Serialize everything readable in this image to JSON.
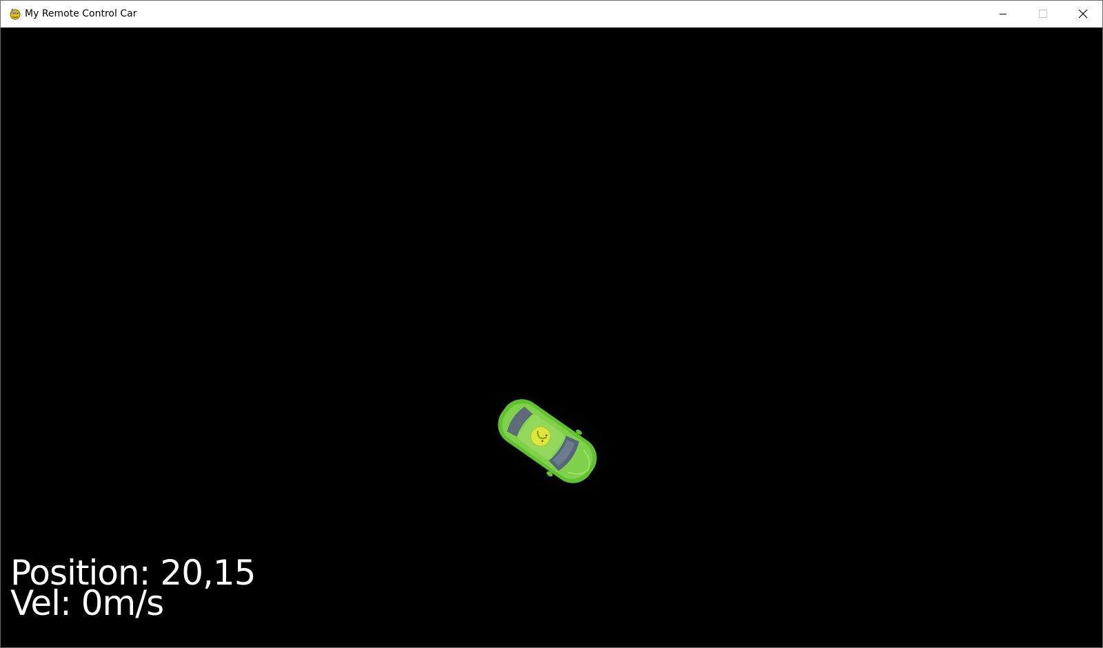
{
  "window": {
    "title": "My Remote Control Car",
    "app_icon": "pygame-snake-icon",
    "controls": {
      "minimize_icon": "minimize-icon",
      "maximize_icon": "maximize-icon",
      "close_icon": "close-icon"
    }
  },
  "game": {
    "background_color": "#000000",
    "car": {
      "icon": "car-sprite",
      "body_color": "#66cc33",
      "roof_emblem": "smiley-icon"
    },
    "hud": {
      "position_text": "Position: 20,15",
      "velocity_text": "Vel: 0m/s",
      "text_color": "#ffffff"
    }
  }
}
